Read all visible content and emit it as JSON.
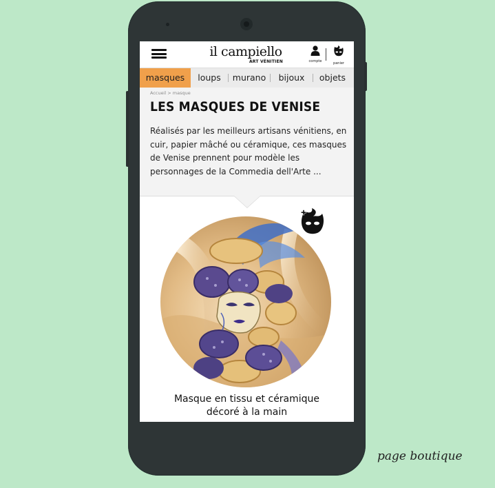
{
  "header": {
    "logo_main": "il campiello",
    "logo_sub": "ART VÉNITIEN",
    "account_label": "compte",
    "cart_label": "panier",
    "icons": [
      "menu-icon",
      "user-icon",
      "mask-cart-icon"
    ]
  },
  "nav": {
    "items": [
      {
        "label": "masques",
        "active": true
      },
      {
        "label": "loups",
        "active": false
      },
      {
        "label": "murano",
        "active": false
      },
      {
        "label": "bijoux",
        "active": false
      },
      {
        "label": "objets",
        "active": false
      }
    ],
    "active_color": "#f0a04b"
  },
  "intro": {
    "breadcrumb": "Accueil > masque",
    "title": "LES MASQUES DE VENISE",
    "description": "Réalisés par les meilleurs artisans vénitiens, en cuir, papier mâché ou céramique, ces masques de Venise prennent pour modèle les personnages de la Commedia dell'Arte ..."
  },
  "product": {
    "name_line1": "Masque en tissu et céramique",
    "name_line2": "décoré à la main",
    "add_icon": "mask-add-icon"
  },
  "caption": "page boutique",
  "colors": {
    "background": "#bde8c8",
    "phone": "#2e3536",
    "accent": "#f0a04b"
  }
}
